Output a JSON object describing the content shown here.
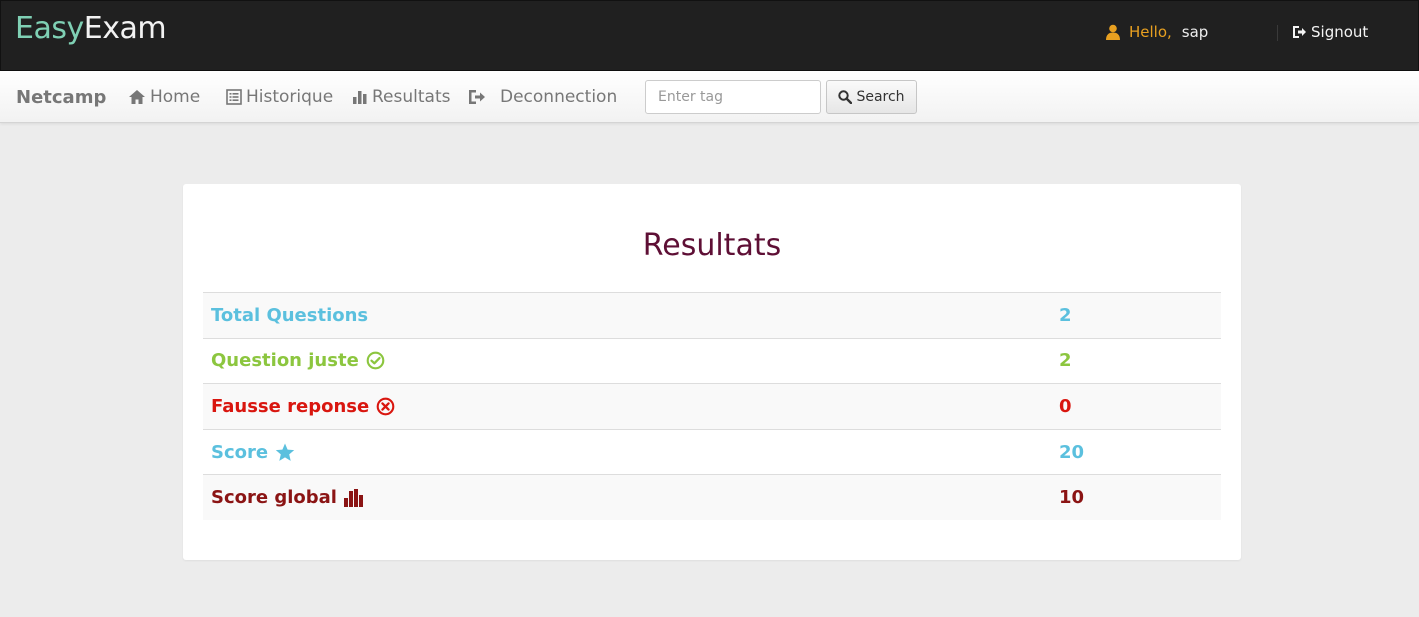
{
  "app": {
    "logo_part1": "Easy",
    "logo_part2": "Exam",
    "greeting": "Hello,",
    "user": "sap",
    "signout_label": "Signout"
  },
  "nav": {
    "brand": "Netcamp",
    "items": [
      {
        "label": "Home",
        "icon": "home-icon"
      },
      {
        "label": "Historique",
        "icon": "list-icon"
      },
      {
        "label": "Resultats",
        "icon": "bar-chart-icon"
      },
      {
        "label": "Deconnection",
        "icon": "sign-out-icon"
      }
    ],
    "search": {
      "placeholder": "Enter tag",
      "value": "",
      "button_label": "Search"
    }
  },
  "results": {
    "title": "Resultats",
    "rows": [
      {
        "label": "Total Questions",
        "value": "2",
        "icon": "",
        "color": "#5bc0de"
      },
      {
        "label": "Question juste",
        "value": "2",
        "icon": "check-circle-icon",
        "color": "#8cc63f"
      },
      {
        "label": "Fausse reponse",
        "value": "0",
        "icon": "times-circle-icon",
        "color": "#d9160f"
      },
      {
        "label": "Score",
        "value": "20",
        "icon": "star-icon",
        "color": "#5bc0de"
      },
      {
        "label": "Score global",
        "value": "10",
        "icon": "bar-chart-icon",
        "color": "#8b1414"
      }
    ]
  },
  "colors": {
    "topbar": "#202020",
    "logo_accent": "#7fd0b4",
    "greeting": "#e8a020",
    "title": "#5e0f35"
  }
}
